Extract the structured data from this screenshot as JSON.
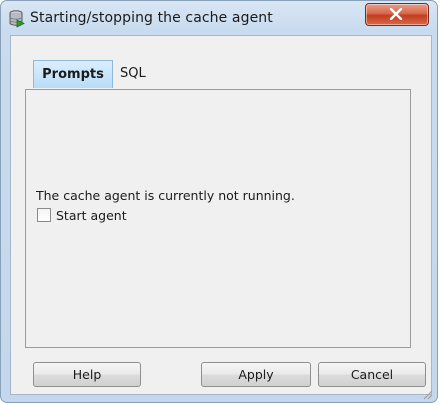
{
  "window": {
    "title": "Starting/stopping the cache agent",
    "icon": "cache-agent-icon",
    "close_icon": "close-icon"
  },
  "tabs": [
    {
      "label": "Prompts",
      "selected": true
    },
    {
      "label": "SQL",
      "selected": false
    }
  ],
  "prompts": {
    "status_text": "The cache agent is currently not running.",
    "start_agent_label": "Start agent",
    "start_agent_checked": false
  },
  "buttons": {
    "help": "Help",
    "apply": "Apply",
    "cancel": "Cancel"
  },
  "colors": {
    "title_bar": "#c8dbef",
    "close_button": "#c23d20",
    "selected_tab": "#b7dcf6"
  }
}
